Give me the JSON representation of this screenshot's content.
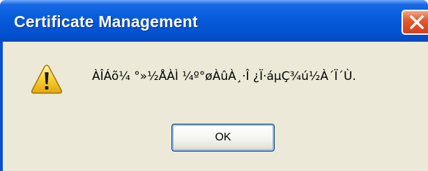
{
  "window": {
    "title": "Certificate Management",
    "title_color": "#ffffff",
    "titlebar_color": "#0556d6",
    "client_color": "#ece9d8"
  },
  "controls": {
    "close_icon": "close-icon"
  },
  "dialog": {
    "icon": "warning-icon",
    "message": "ÀÎÁõ¼­ °»½ÅÀÌ ¼º°øÀûÀ¸·Î ¿Ï·áµÇ¾ú½À´Ï´Ù.",
    "ok_label": "OK"
  }
}
